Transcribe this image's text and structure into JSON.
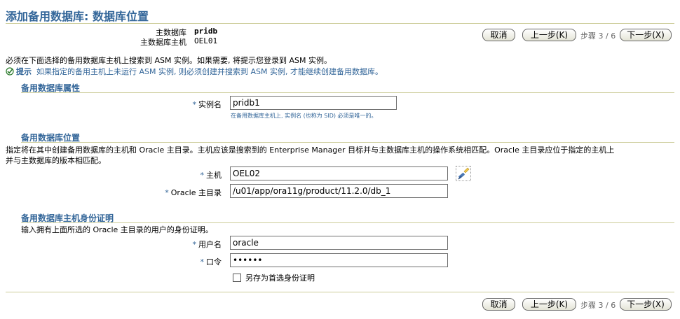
{
  "page": {
    "title": "添加备用数据库: 数据库位置"
  },
  "info": {
    "primary_db_label": "主数据库",
    "primary_db_value": "pridb",
    "primary_host_label": "主数据库主机",
    "primary_host_value": "OEL01"
  },
  "nav": {
    "cancel": "取消",
    "back": "上一步(K)",
    "step": "步骤 3 / 6",
    "next": "下一步(X)"
  },
  "intro": {
    "text": "必须在下面选择的备用数据库主机上搜索到 ASM 实例。如果需要, 将提示您登录到 ASM 实例。",
    "tip_label": "提示",
    "tip_text": "如果指定的备用主机上未运行 ASM 实例, 则必须创建并搜索到 ASM 实例, 才能继续创建备用数据库。"
  },
  "attributes": {
    "heading": "备用数据库属性",
    "instance_label": "实例名",
    "instance_value": "pridb1",
    "instance_hint": "在备用数据库主机上, 实例名 (也称为 SID) 必须是唯一的。"
  },
  "location": {
    "heading": "备用数据库位置",
    "desc_line1": "指定将在其中创建备用数据库的主机和 Oracle 主目录。主机应该是搜索到的 Enterprise Manager 目标并与主数据库主机的操作系统相匹配。Oracle 主目录应位于指定的主机上",
    "desc_line2": "并与主数据库的版本相匹配。",
    "host_label": "主机",
    "host_value": "OEL02",
    "home_label": "Oracle 主目录",
    "home_value": "/u01/app/ora11g/product/11.2.0/db_1"
  },
  "credentials": {
    "heading": "备用数据库主机身份证明",
    "desc": "输入拥有上面所选的 Oracle 主目录的用户的身份证明。",
    "user_label": "用户名",
    "user_value": "oracle",
    "pwd_label": "口令",
    "pwd_value": "••••••",
    "save_label": "另存为首选身份证明"
  },
  "required_mark": "*"
}
